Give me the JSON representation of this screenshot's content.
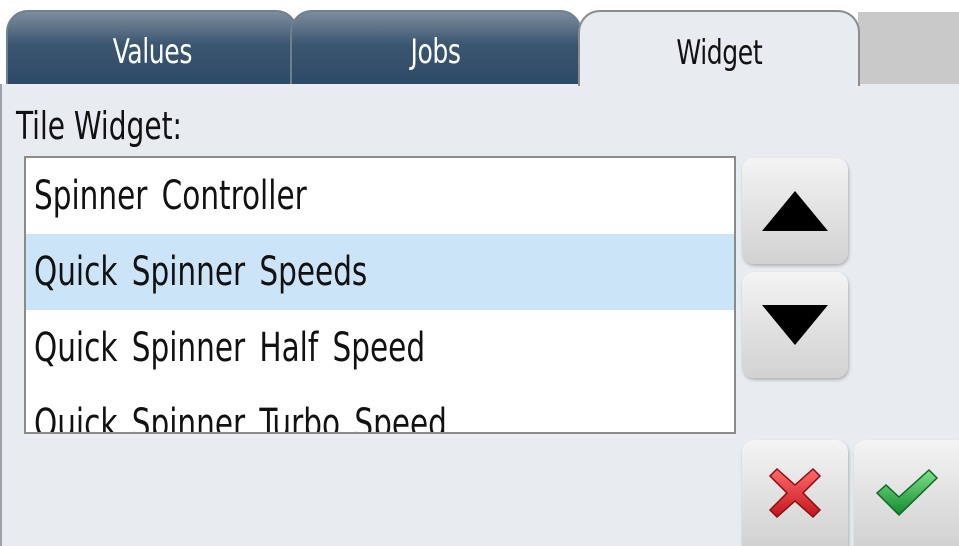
{
  "tabs": [
    {
      "label": "Values",
      "active": false
    },
    {
      "label": "Jobs",
      "active": false
    },
    {
      "label": "Widget",
      "active": true
    }
  ],
  "heading": "Tile Widget:",
  "list": {
    "items": [
      {
        "label": "Spinner Controller",
        "selected": false
      },
      {
        "label": "Quick Spinner Speeds",
        "selected": true
      },
      {
        "label": "Quick Spinner Half Speed",
        "selected": false
      },
      {
        "label": "Quick Spinner Turbo Speed",
        "selected": false
      }
    ]
  },
  "buttons": {
    "up": {
      "icon": "triangle-up-icon"
    },
    "down": {
      "icon": "triangle-down-icon"
    },
    "cancel": {
      "icon": "x-icon",
      "color": "#d8232a"
    },
    "ok": {
      "icon": "check-icon",
      "color": "#1e9e3a"
    }
  },
  "colors": {
    "tab_dark": "#2d4a66",
    "selection": "#cce4f7",
    "panel": "#e8ecf0"
  }
}
